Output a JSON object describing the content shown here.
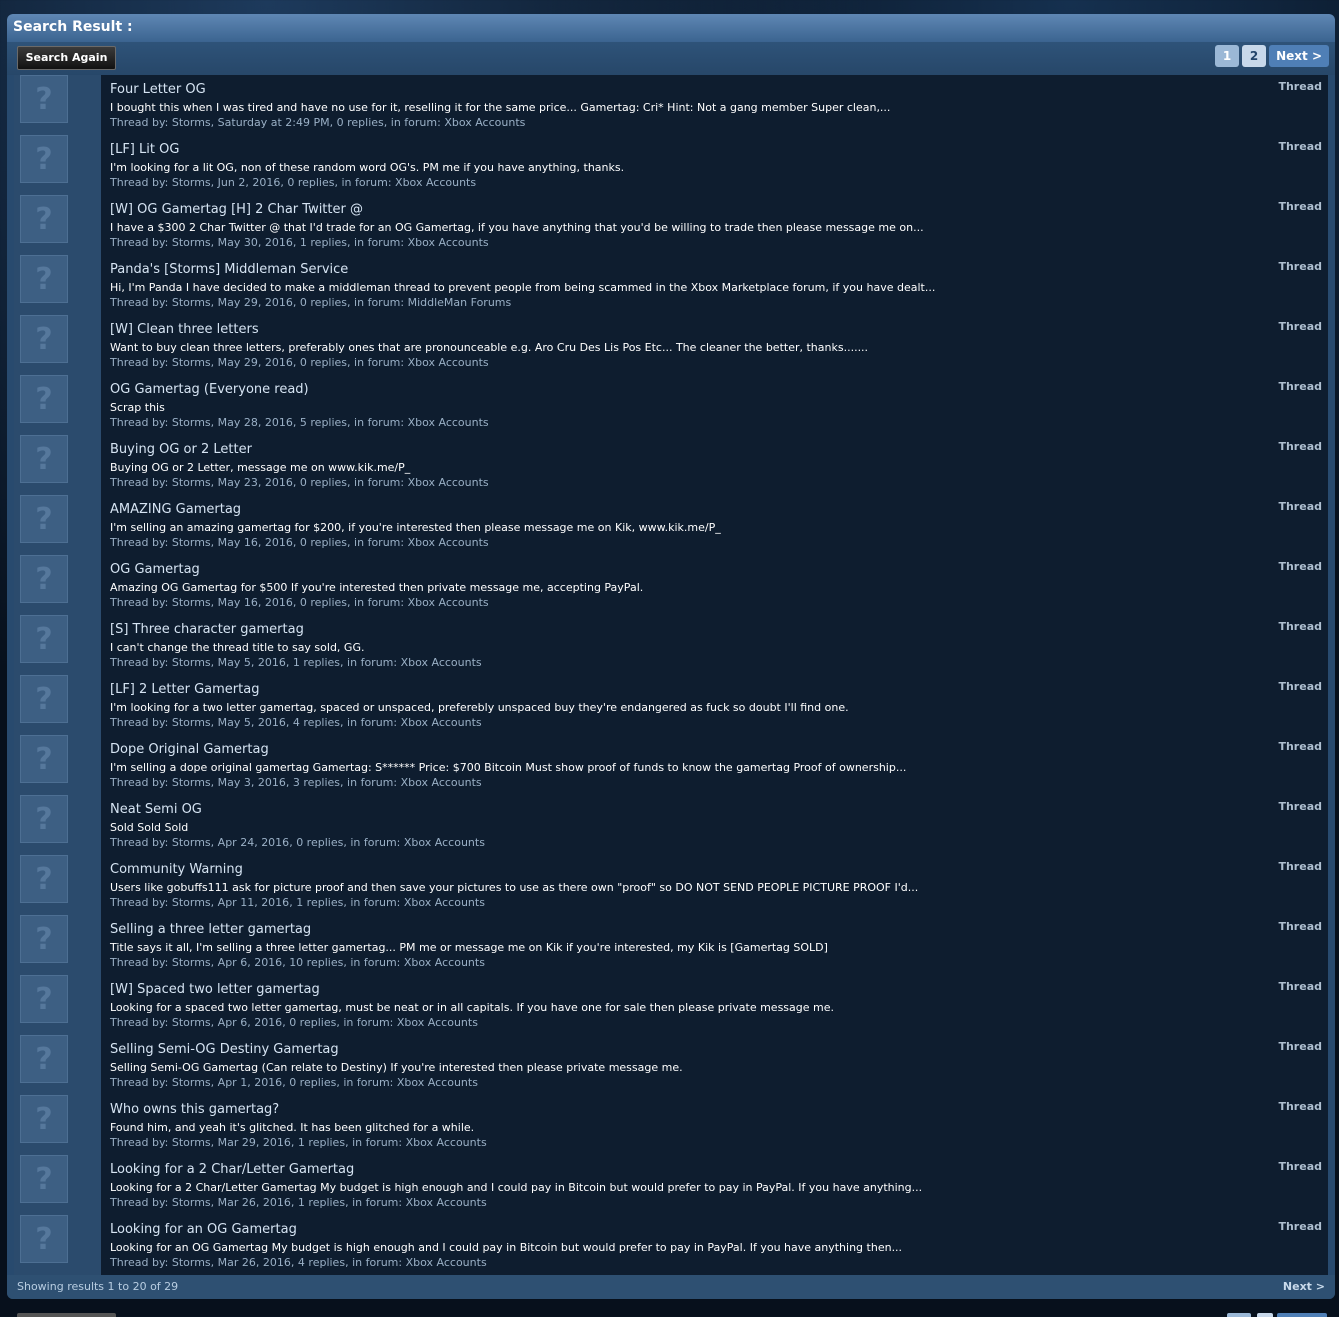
{
  "header": {
    "title": "Search Result :"
  },
  "toolbar": {
    "search_again_label": "Search Again",
    "pages": [
      "1",
      "2"
    ],
    "next_label": "Next >"
  },
  "results": [
    {
      "title": "Four Letter OG",
      "snippet": "I bought this when I was tired and have no use for it, reselling it for the same price... Gamertag: Cri* Hint: Not a gang member Super clean,...",
      "author": "Storms",
      "date": "Saturday at 2:49 PM",
      "replies": "0 replies",
      "forum": "Xbox Accounts",
      "type": "Thread"
    },
    {
      "title": "[LF] Lit OG",
      "snippet": "I'm looking for a lit OG, non of these random word OG's. PM me if you have anything, thanks.",
      "author": "Storms",
      "date": "Jun 2, 2016",
      "replies": "0 replies",
      "forum": "Xbox Accounts",
      "type": "Thread"
    },
    {
      "title": "[W] OG Gamertag [H] 2 Char Twitter @",
      "snippet": "I have a $300 2 Char Twitter @ that I'd trade for an OG Gamertag, if you have anything that you'd be willing to trade then please message me on...",
      "author": "Storms",
      "date": "May 30, 2016",
      "replies": "1 replies",
      "forum": "Xbox Accounts",
      "type": "Thread"
    },
    {
      "title": "Panda's [Storms] Middleman Service",
      "snippet": "Hi, I'm Panda I have decided to make a middleman thread to prevent people from being scammed in the Xbox Marketplace forum, if you have dealt...",
      "author": "Storms",
      "date": "May 29, 2016",
      "replies": "0 replies",
      "forum": "MiddleMan Forums",
      "type": "Thread"
    },
    {
      "title": "[W] Clean three letters",
      "snippet": "Want to buy clean three letters, preferably ones that are pronounceable e.g. Aro Cru Des Lis Pos Etc... The cleaner the better, thanks.......",
      "author": "Storms",
      "date": "May 29, 2016",
      "replies": "0 replies",
      "forum": "Xbox Accounts",
      "type": "Thread"
    },
    {
      "title": "OG Gamertag (Everyone read)",
      "snippet": "Scrap this",
      "author": "Storms",
      "date": "May 28, 2016",
      "replies": "5 replies",
      "forum": "Xbox Accounts",
      "type": "Thread"
    },
    {
      "title": "Buying OG or 2 Letter",
      "snippet": "Buying OG or 2 Letter, message me on www.kik.me/P_",
      "author": "Storms",
      "date": "May 23, 2016",
      "replies": "0 replies",
      "forum": "Xbox Accounts",
      "type": "Thread"
    },
    {
      "title": "AMAZING Gamertag",
      "snippet": "I'm selling an amazing gamertag for $200, if you're interested then please message me on Kik, www.kik.me/P_",
      "author": "Storms",
      "date": "May 16, 2016",
      "replies": "0 replies",
      "forum": "Xbox Accounts",
      "type": "Thread"
    },
    {
      "title": "OG Gamertag",
      "snippet": "Amazing OG Gamertag for $500 If you're interested then private message me, accepting PayPal.",
      "author": "Storms",
      "date": "May 16, 2016",
      "replies": "0 replies",
      "forum": "Xbox Accounts",
      "type": "Thread"
    },
    {
      "title": "[S] Three character gamertag",
      "snippet": "I can't change the thread title to say sold, GG.",
      "author": "Storms",
      "date": "May 5, 2016",
      "replies": "1 replies",
      "forum": "Xbox Accounts",
      "type": "Thread"
    },
    {
      "title": "[LF] 2 Letter Gamertag",
      "snippet": "I'm looking for a two letter gamertag, spaced or unspaced, preferebly unspaced buy they're endangered as fuck so doubt I'll find one.",
      "author": "Storms",
      "date": "May 5, 2016",
      "replies": "4 replies",
      "forum": "Xbox Accounts",
      "type": "Thread"
    },
    {
      "title": "Dope Original Gamertag",
      "snippet": "I'm selling a dope original gamertag Gamertag: S****** Price: $700 Bitcoin Must show proof of funds to know the gamertag Proof of ownership...",
      "author": "Storms",
      "date": "May 3, 2016",
      "replies": "3 replies",
      "forum": "Xbox Accounts",
      "type": "Thread"
    },
    {
      "title": "Neat Semi OG",
      "snippet": "Sold Sold Sold",
      "author": "Storms",
      "date": "Apr 24, 2016",
      "replies": "0 replies",
      "forum": "Xbox Accounts",
      "type": "Thread"
    },
    {
      "title": "Community Warning",
      "snippet": "Users like gobuffs111 ask for picture proof and then save your pictures to use as there own \"proof\" so DO NOT SEND PEOPLE PICTURE PROOF I'd...",
      "author": "Storms",
      "date": "Apr 11, 2016",
      "replies": "1 replies",
      "forum": "Xbox Accounts",
      "type": "Thread"
    },
    {
      "title": "Selling a three letter gamertag",
      "snippet": "Title says it all, I'm selling a three letter gamertag... PM me or message me on Kik if you're interested, my Kik is [Gamertag SOLD]",
      "author": "Storms",
      "date": "Apr 6, 2016",
      "replies": "10 replies",
      "forum": "Xbox Accounts",
      "type": "Thread"
    },
    {
      "title": "[W] Spaced two letter gamertag",
      "snippet": "Looking for a spaced two letter gamertag, must be neat or in all capitals. If you have one for sale then please private message me.",
      "author": "Storms",
      "date": "Apr 6, 2016",
      "replies": "0 replies",
      "forum": "Xbox Accounts",
      "type": "Thread"
    },
    {
      "title": "Selling Semi-OG Destiny Gamertag",
      "snippet": "Selling Semi-OG Gamertag (Can relate to Destiny) If you're interested then please private message me.",
      "author": "Storms",
      "date": "Apr 1, 2016",
      "replies": "0 replies",
      "forum": "Xbox Accounts",
      "type": "Thread"
    },
    {
      "title": "Who owns this gamertag?",
      "snippet": "Found him, and yeah it's glitched. It has been glitched for a while.",
      "author": "Storms",
      "date": "Mar 29, 2016",
      "replies": "1 replies",
      "forum": "Xbox Accounts",
      "type": "Thread"
    },
    {
      "title": "Looking for a 2 Char/Letter Gamertag",
      "snippet": "Looking for a 2 Char/Letter Gamertag My budget is high enough and I could pay in Bitcoin but would prefer to pay in PayPal. If you have anything...",
      "author": "Storms",
      "date": "Mar 26, 2016",
      "replies": "1 replies",
      "forum": "Xbox Accounts",
      "type": "Thread"
    },
    {
      "title": "Looking for an OG Gamertag",
      "snippet": "Looking for an OG Gamertag My budget is high enough and I could pay in Bitcoin but would prefer to pay in PayPal. If you have anything then...",
      "author": "Storms",
      "date": "Mar 26, 2016",
      "replies": "4 replies",
      "forum": "Xbox Accounts",
      "type": "Thread"
    }
  ],
  "labels": {
    "thread_by": "Thread by:",
    "in_forum": "in forum:"
  },
  "footer": {
    "count_text": "Showing results 1 to 20 of 29",
    "next_label": "Next >"
  }
}
